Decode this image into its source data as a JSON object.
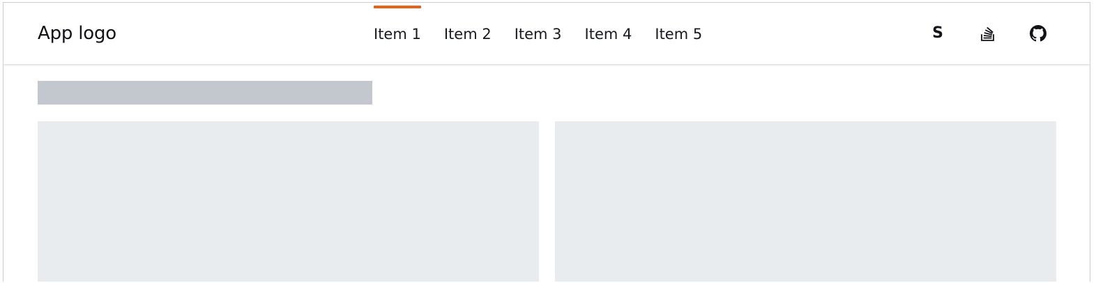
{
  "header": {
    "logo_text": "App logo",
    "nav_items": [
      {
        "label": "Item 1",
        "active": true
      },
      {
        "label": "Item 2",
        "active": false
      },
      {
        "label": "Item 3",
        "active": false
      },
      {
        "label": "Item 4",
        "active": false
      },
      {
        "label": "Item 5",
        "active": false
      }
    ],
    "icons": [
      {
        "name": "s-brand-icon",
        "glyph": "S"
      },
      {
        "name": "stack-overflow-icon"
      },
      {
        "name": "github-icon"
      }
    ]
  },
  "colors": {
    "accent": "#e0661d",
    "text": "#161a22",
    "skeleton_dark": "#c3c8cf",
    "skeleton_light": "#e9ecef"
  }
}
